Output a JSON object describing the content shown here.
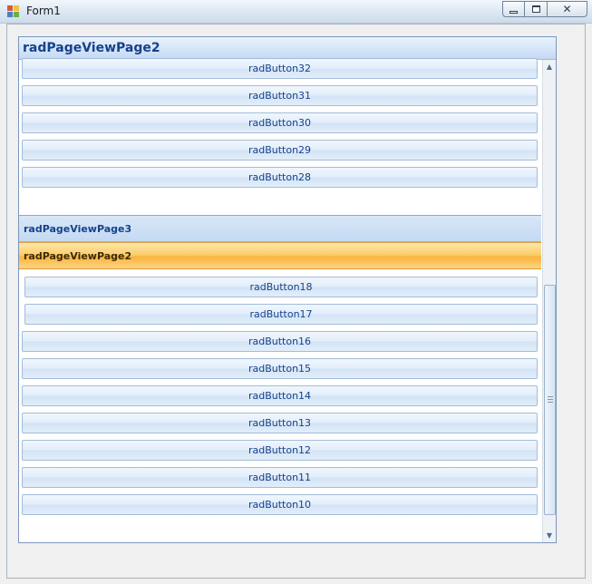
{
  "window": {
    "title": "Form1",
    "icon": "app-form-icon",
    "controls": {
      "minimize": "minimize-icon",
      "maximize": "maximize-icon",
      "close": "close-icon"
    }
  },
  "pageview": {
    "header_title": "radPageViewPage2",
    "top_buttons": [
      "radButton32",
      "radButton31",
      "radButton30",
      "radButton29",
      "radButton28"
    ],
    "groups": [
      {
        "label": "radPageViewPage3",
        "state": "normal"
      },
      {
        "label": "radPageViewPage2",
        "state": "selected"
      }
    ],
    "bottom_buttons": [
      "radButton18",
      "radButton17",
      "radButton16",
      "radButton15",
      "radButton14",
      "radButton13",
      "radButton12",
      "radButton11",
      "radButton10"
    ]
  },
  "scrollbar": {
    "up_icon": "scroll-up-arrow-icon",
    "down_icon": "scroll-down-arrow-icon",
    "grip_icon": "grip-icon"
  },
  "colors": {
    "header": "#d5e5f8",
    "selected_group": "#fbb43e",
    "text": "#15428b"
  }
}
